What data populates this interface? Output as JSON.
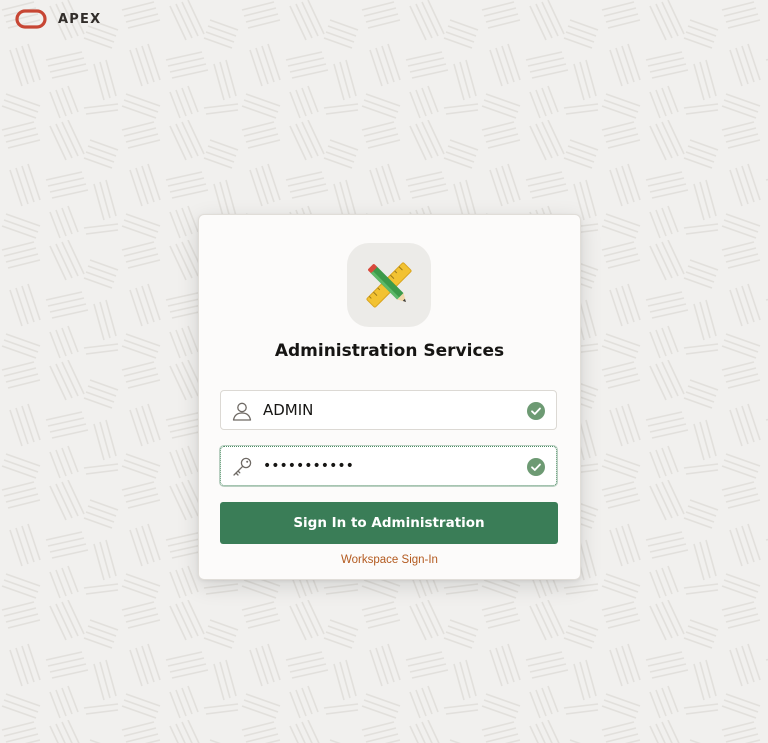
{
  "header": {
    "brand": "APEX",
    "logo_icon": "oracle-logo-icon",
    "logo_color": "#c74634"
  },
  "login": {
    "app_icon": "pencil-ruler-icon",
    "title": "Administration Services",
    "username": {
      "icon": "user-icon",
      "value": "ADMIN",
      "status_icon": "check-circle-icon"
    },
    "password": {
      "icon": "key-icon",
      "value": "•••••••••••",
      "status_icon": "check-circle-icon"
    },
    "submit_label": "Sign In to Administration",
    "workspace_link": "Workspace Sign-In"
  },
  "colors": {
    "primary_button": "#3a7d57",
    "success": "#6d9a73",
    "link": "#b35a1f",
    "background": "#f1f0ee"
  }
}
